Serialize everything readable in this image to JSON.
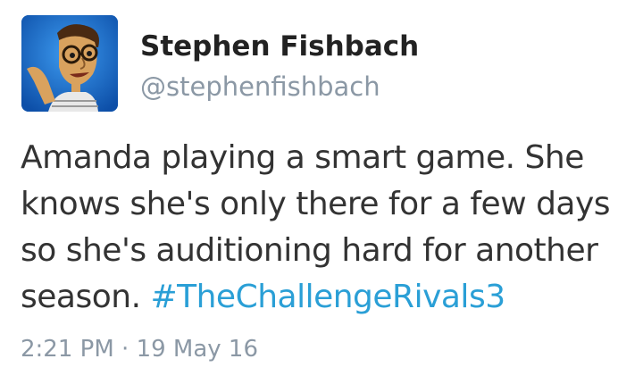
{
  "tweet": {
    "author_name": "Stephen Fishbach",
    "author_handle": "@stephenfishbach",
    "text_lines": [
      "Amanda playing a smart game. She",
      "knows she's only there for a few days",
      "so she's auditioning hard for another"
    ],
    "text_last_prefix": "season. ",
    "hashtag": "#TheChallengeRivals3",
    "time": "2:21 PM",
    "separator": " · ",
    "date": "19 May 16"
  },
  "colors": {
    "hashtag": "#2a9fd6",
    "muted": "#8b98a5",
    "text": "#333333"
  }
}
